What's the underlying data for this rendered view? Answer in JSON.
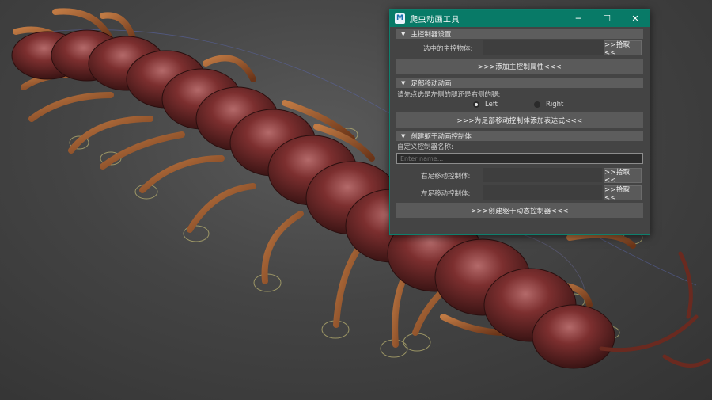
{
  "window": {
    "title": "爬虫动画工具",
    "app_icon_text": "M",
    "controls": {
      "minimize": "─",
      "maximize": "☐",
      "close": "✕"
    }
  },
  "section_main": {
    "header": "主控制器设置",
    "selected_label": "选中的主控物体:",
    "pick_label": ">>拾取<<",
    "add_attr_label": ">>>添加主控制属性<<<"
  },
  "section_foot": {
    "header": "足部移动动画",
    "instruction": "请先点选是左侧的腿还是右侧的腿:",
    "radio_left": "Left",
    "radio_right": "Right",
    "selected_side": "Left",
    "add_expr_label": ">>>为足部移动控制体添加表达式<<<"
  },
  "section_torso": {
    "header": "创建躯干动画控制体",
    "name_label": "自定义控制器名称:",
    "name_placeholder": "Enter name...",
    "right_foot_label": "右足移动控制体:",
    "left_foot_label": "左足移动控制体:",
    "pick_label": ">>拾取<<",
    "create_label": ">>>创建躯干动态控制器<<<"
  },
  "colors": {
    "titlebar": "#087a67",
    "panel": "#444444",
    "section_header": "#5d5d5d",
    "button": "#5a5a5a"
  }
}
